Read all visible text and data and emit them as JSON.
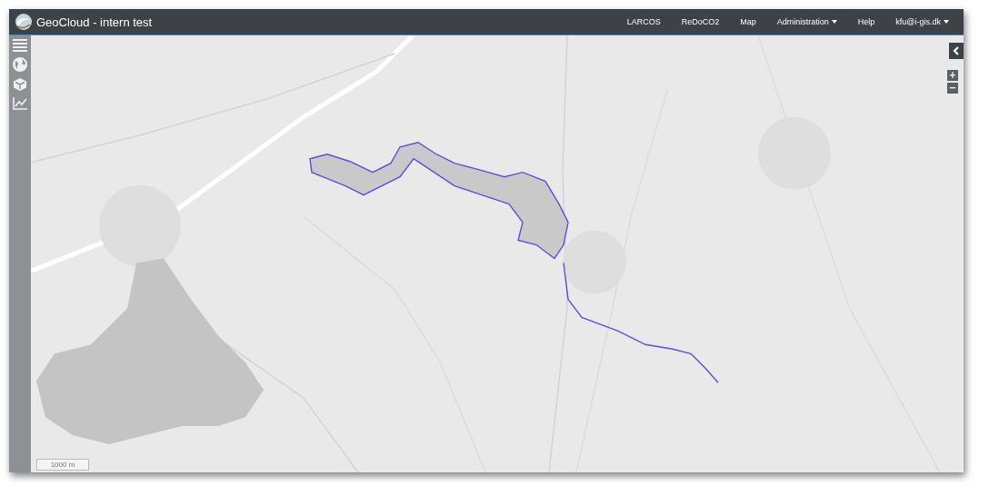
{
  "app": {
    "title": "GeoCloud - intern test"
  },
  "nav": [
    {
      "label": "LARCOS",
      "dropdown": false
    },
    {
      "label": "ReDoCO2",
      "dropdown": false
    },
    {
      "label": "Map",
      "dropdown": false
    },
    {
      "label": "Administration",
      "dropdown": true
    },
    {
      "label": "Help",
      "dropdown": false
    },
    {
      "label": "kfu@i-gis.dk",
      "dropdown": true
    }
  ],
  "sidebar": {
    "tools": [
      {
        "kind": "layers"
      },
      {
        "kind": "globe"
      },
      {
        "kind": "cube"
      },
      {
        "kind": "chart"
      }
    ]
  },
  "map": {
    "zoom_controls": [
      "+",
      "−"
    ],
    "scale": "1000 m"
  }
}
